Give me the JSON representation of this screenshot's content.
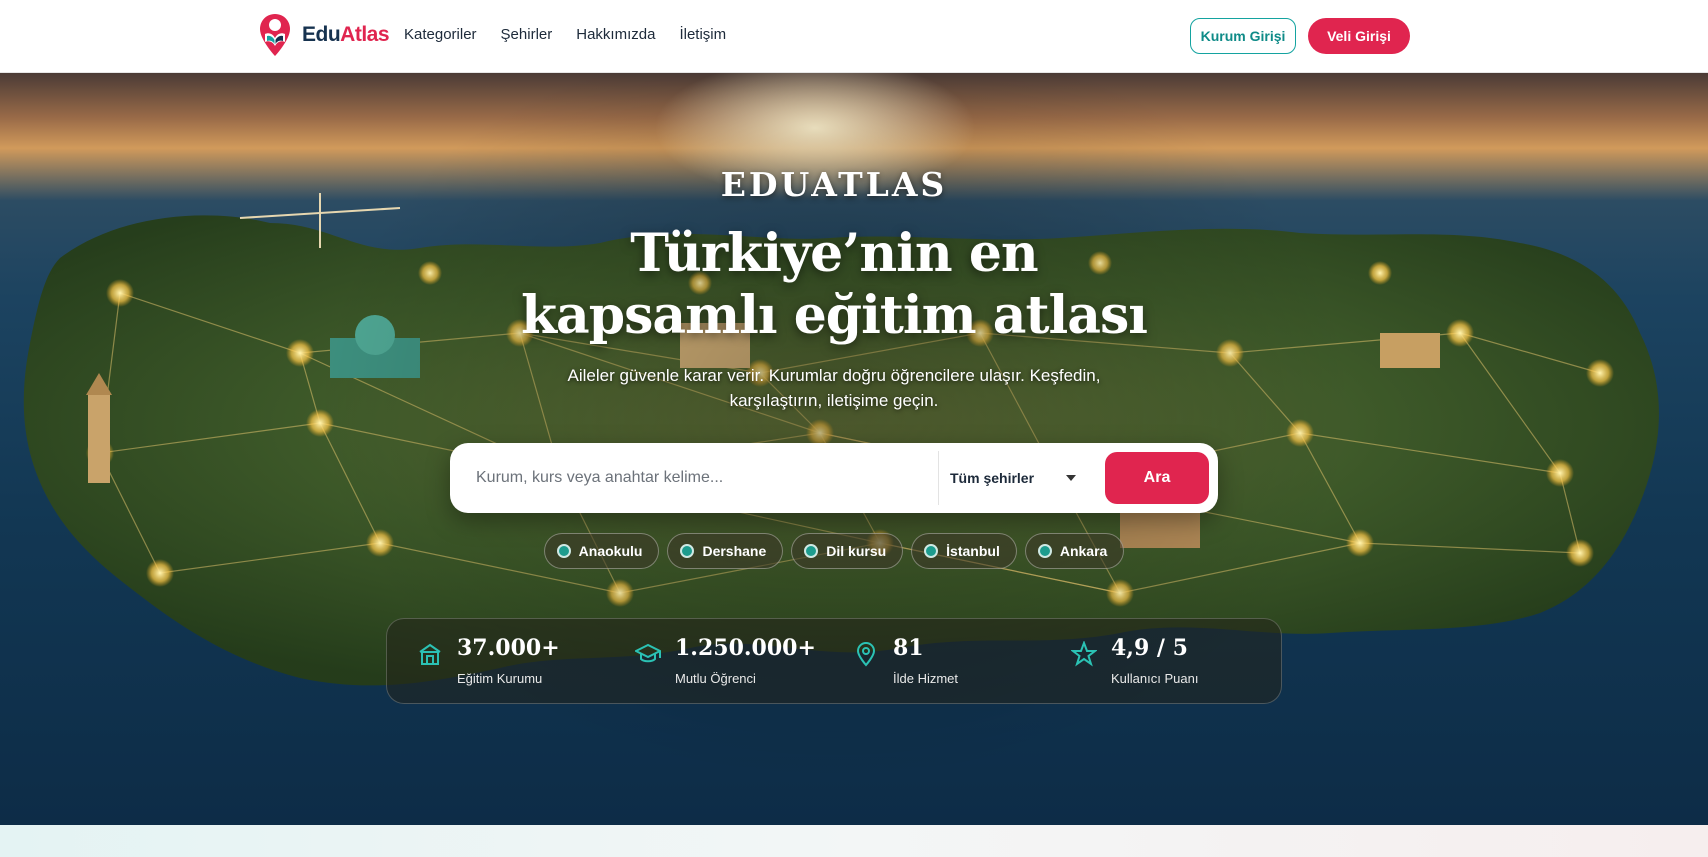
{
  "header": {
    "logo": {
      "edu": "Edu",
      "atlas": "Atlas"
    },
    "nav": [
      "Kategoriler",
      "Şehirler",
      "Hakkımızda",
      "İletişim"
    ],
    "institution_login": "Kurum Girişi",
    "parent_login": "Veli Girişi"
  },
  "hero": {
    "eyebrow": "EDUATLAS",
    "headline_line1": "Türkiye’nin en",
    "headline_line2": "kapsamlı eğitim atlası",
    "subtitle": "Aileler güvenle karar verir. Kurumlar doğru öğrencilere ulaşır. Keşfedin, karşılaştırın, iletişime geçin.",
    "search": {
      "placeholder": "Kurum, kurs veya anahtar kelime...",
      "city_selected": "Tüm şehirler",
      "button": "Ara"
    },
    "chips": [
      "Anaokulu",
      "Dershane",
      "Dil kursu",
      "İstanbul",
      "Ankara"
    ],
    "stats": [
      {
        "icon": "school-icon",
        "value": "37.000+",
        "label": "Eğitim Kurumu"
      },
      {
        "icon": "graduation-cap-icon",
        "value": "1.250.000+",
        "label": "Mutlu Öğrenci"
      },
      {
        "icon": "map-pin-icon",
        "value": "81",
        "label": "İlde Hizmet"
      },
      {
        "icon": "star-icon",
        "value": "4,9 / 5",
        "label": "Kullanıcı Puanı"
      }
    ]
  },
  "colors": {
    "brand_red": "#e0254f",
    "brand_teal": "#14a3a0",
    "brand_navy": "#16324f"
  }
}
